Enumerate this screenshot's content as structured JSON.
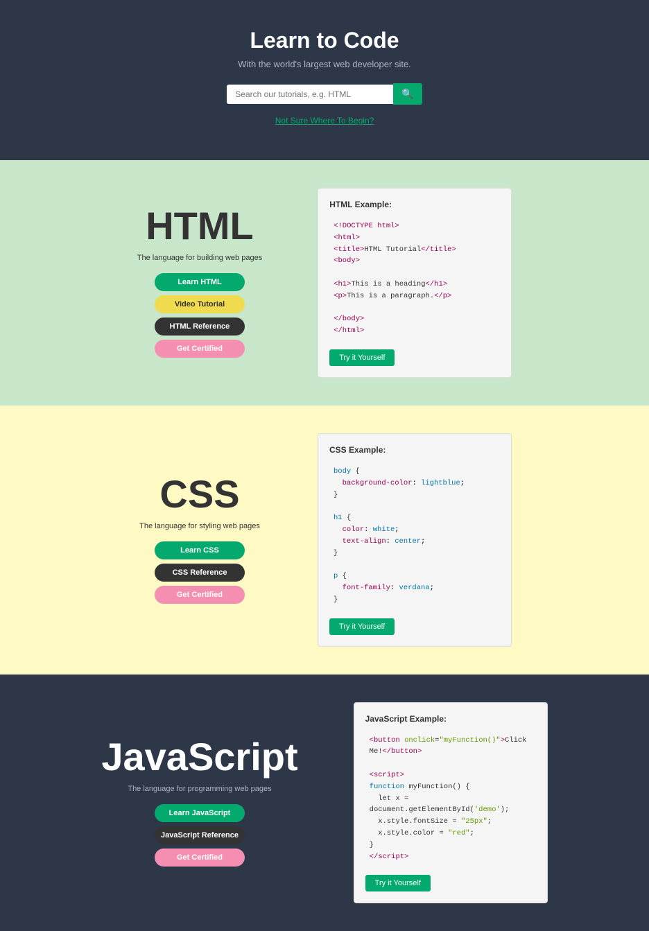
{
  "header": {
    "title": "Learn to Code",
    "tagline": "With the world's largest web developer site.",
    "search_placeholder": "Search our tutorials, e.g. HTML",
    "not_sure_label": "Not Sure Where To Begin?"
  },
  "sections": [
    {
      "id": "html",
      "title": "HTML",
      "desc": "The language for building web pages",
      "buttons": [
        {
          "label": "Learn HTML",
          "style": "green"
        },
        {
          "label": "Video Tutorial",
          "style": "yellow"
        },
        {
          "label": "HTML Reference",
          "style": "dark"
        },
        {
          "label": "Get Certified",
          "style": "pink"
        }
      ],
      "example_title": "HTML Example:",
      "try_label": "Try it Yourself"
    },
    {
      "id": "css",
      "title": "CSS",
      "desc": "The language for styling web pages",
      "buttons": [
        {
          "label": "Learn CSS",
          "style": "green"
        },
        {
          "label": "CSS Reference",
          "style": "dark"
        },
        {
          "label": "Get Certified",
          "style": "pink"
        }
      ],
      "example_title": "CSS Example:",
      "try_label": "Try it Yourself"
    },
    {
      "id": "js",
      "title": "JavaScript",
      "desc": "The language for programming web pages",
      "buttons": [
        {
          "label": "Learn JavaScript",
          "style": "green"
        },
        {
          "label": "JavaScript Reference",
          "style": "dark"
        },
        {
          "label": "Get Certified",
          "style": "pink"
        }
      ],
      "example_title": "JavaScript Example:",
      "try_label": "Try it Yourself"
    }
  ]
}
